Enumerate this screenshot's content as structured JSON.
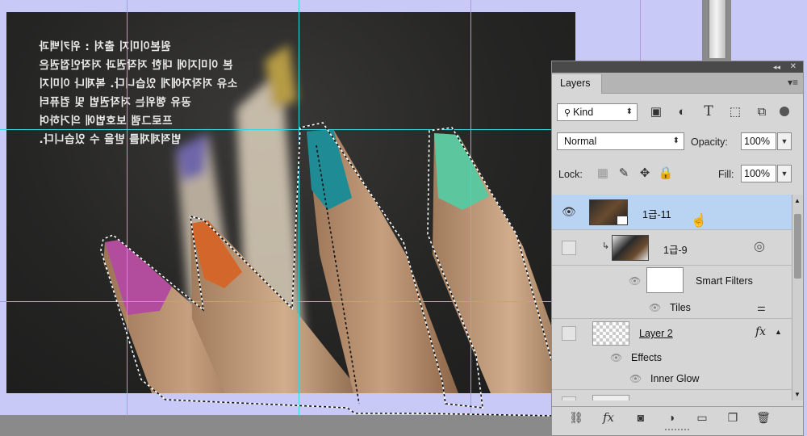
{
  "artwork": {
    "mirrored_text_lines": [
      "원본이미지 출처 : 위키백과",
      "본 이미지에 대한 저작권과 저작인접권은",
      "소유 저작자에게 있습니다. 복제나 이미지",
      "공유 행위는 저작권법 및 컴퓨터",
      "프로그램 보호법에 의거하여",
      "법적제재를 받을 수 있습니다."
    ]
  },
  "layers_panel": {
    "tab_label": "Layers",
    "filter": {
      "kind_label": "Kind"
    },
    "blend_mode": "Normal",
    "opacity_label": "Opacity:",
    "opacity_value": "100%",
    "lock_label": "Lock:",
    "fill_label": "Fill:",
    "fill_value": "100%",
    "layers": [
      {
        "name": "1급-11",
        "visible": true,
        "selected": true
      },
      {
        "name": "1급-9",
        "visible": false,
        "selected": false,
        "smart_filters_label": "Smart Filters",
        "filter_name": "Tiles"
      },
      {
        "name": "Layer 2",
        "visible": false,
        "selected": false,
        "effects_label": "Effects",
        "effect_name": "Inner Glow",
        "fx_label": "fx"
      }
    ],
    "footer_icons": [
      "link-icon",
      "fx-icon",
      "mask-icon",
      "adjustment-icon",
      "folder-icon",
      "new-layer-icon",
      "trash-icon"
    ],
    "footer_fx_label": "fx"
  },
  "colors": {
    "guide": "#36d6e0",
    "selected_row": "#b9d3f3",
    "pasteboard": "#c9c9f7"
  }
}
